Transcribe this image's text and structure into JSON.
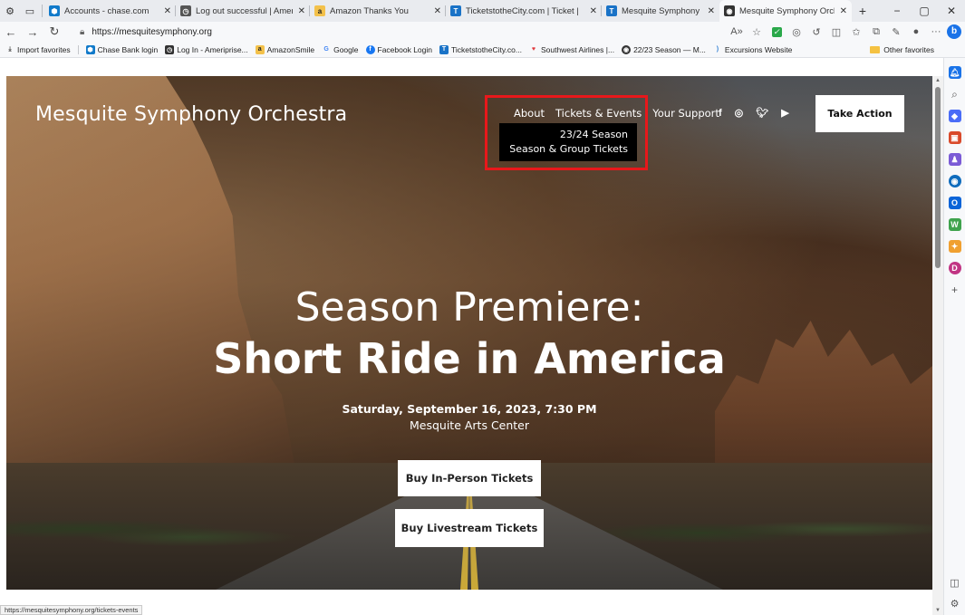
{
  "browser": {
    "tabs": [
      {
        "title": "Accounts - chase.com",
        "fav_color": "#117aca",
        "fav_glyph": "⬢"
      },
      {
        "title": "Log out successful | Ameripris",
        "fav_color": "#333333",
        "fav_glyph": "◷"
      },
      {
        "title": "Amazon Thanks You",
        "fav_color": "#f3c14b",
        "fav_glyph": "a"
      },
      {
        "title": "TicketstotheCity.com | Ticket |",
        "fav_color": "#1a73c7",
        "fav_glyph": "T"
      },
      {
        "title": "Mesquite Symphony Orchestr",
        "fav_color": "#1a73c7",
        "fav_glyph": "T"
      },
      {
        "title": "Mesquite Symphony Orchestr",
        "fav_color": "#333333",
        "fav_glyph": "◉",
        "active": true
      }
    ],
    "url": "https://mesquitesymphony.org",
    "favorites": [
      {
        "label": "Import favorites",
        "color": "#666666",
        "glyph": "⤓"
      },
      {
        "label": "Chase Bank login",
        "color": "#117aca",
        "glyph": "⬢"
      },
      {
        "label": "Log In - Ameriprise...",
        "color": "#333333",
        "glyph": "◷"
      },
      {
        "label": "AmazonSmile",
        "color": "#f3c14b",
        "glyph": "a"
      },
      {
        "label": "Google",
        "color": "#4285f4",
        "glyph": "G"
      },
      {
        "label": "Facebook Login",
        "color": "#1877f2",
        "glyph": "f"
      },
      {
        "label": "TicketstotheCity.co...",
        "color": "#1a73c7",
        "glyph": "T"
      },
      {
        "label": "Southwest Airlines |...",
        "color": "#e03a3e",
        "glyph": "♥"
      },
      {
        "label": "22/23 Season — M...",
        "color": "#333333",
        "glyph": "◉"
      },
      {
        "label": "Excursions Website",
        "color": "#2d7dd2",
        "glyph": ")"
      }
    ],
    "other_favorites": "Other favorites",
    "status_url": "https://mesquitesymphony.org/tickets-events"
  },
  "site": {
    "title": "Mesquite Symphony Orchestra",
    "nav": {
      "about": "About",
      "tickets": "Tickets & Events",
      "support": "Your Support"
    },
    "social_icons": [
      "facebook-icon",
      "instagram-icon",
      "twitter-icon",
      "youtube-icon"
    ],
    "take_action": "Take Action",
    "dropdown": {
      "item1": "23/24 Season",
      "item2": "Season & Group Tickets"
    },
    "hero": {
      "line1": "Season Premiere:",
      "line2": "Short Ride in America",
      "date": "Saturday, September 16, 2023, 7:30 PM",
      "venue": "Mesquite Arts Center",
      "btn_inperson": "Buy In-Person Tickets",
      "btn_livestream": "Buy Livestream Tickets"
    }
  },
  "colors": {
    "highlight": "#e8181b",
    "dropdown_bg": "#000000"
  }
}
